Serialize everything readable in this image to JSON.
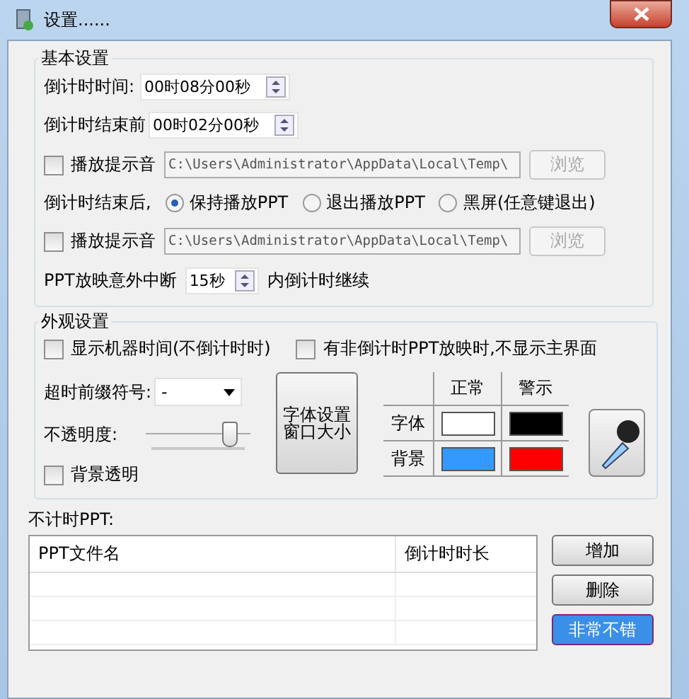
{
  "window": {
    "title": "设置......"
  },
  "basic": {
    "title": "基本设置",
    "countdown": {
      "label": "倒计时时间:",
      "value": "00时08分00秒"
    },
    "before_end": {
      "label": "倒计时结束前",
      "value": "00时02分00秒"
    },
    "sound1": {
      "label": "播放提示音",
      "checked": false,
      "path": "C:\\Users\\Administrator\\AppData\\Local\\Temp\\",
      "browse": "浏览"
    },
    "after_end": {
      "label": "倒计时结束后,",
      "options": [
        {
          "label": "保持播放PPT",
          "selected": true
        },
        {
          "label": "退出播放PPT",
          "selected": false
        },
        {
          "label": "黑屏(任意键退出)",
          "selected": false
        }
      ]
    },
    "sound2": {
      "label": "播放提示音",
      "checked": false,
      "path": "C:\\Users\\Administrator\\AppData\\Local\\Temp\\",
      "browse": "浏览"
    },
    "interrupt": {
      "label": "PPT放映意外中断",
      "value": "15秒",
      "suffix": "内倒计时继续"
    }
  },
  "appearance": {
    "title": "外观设置",
    "show_clock": {
      "label": "显示机器时间(不倒计时时)",
      "checked": false
    },
    "hide_main": {
      "label": "有非倒计时PPT放映时,不显示主界面",
      "checked": false
    },
    "prefix": {
      "label": "超时前缀符号:",
      "value": "-"
    },
    "opacity": {
      "label": "不透明度:",
      "level": 0.8
    },
    "transparent": {
      "label": "背景透明",
      "checked": false
    },
    "font_button": [
      "字体设置",
      "窗口大小"
    ],
    "colors": {
      "columns": [
        "正常",
        "警示"
      ],
      "rows": [
        {
          "label": "字体",
          "swatches": [
            {
              "color": "#ffffff"
            },
            {
              "color": "#000000"
            }
          ]
        },
        {
          "label": "背景",
          "swatches": [
            {
              "color": "#3399ff"
            },
            {
              "color": "#ff0000"
            }
          ]
        }
      ]
    }
  },
  "untimed": {
    "label": "不计时PPT:",
    "columns": [
      "PPT文件名",
      "倒计时时长"
    ],
    "buttons": [
      "增加",
      "删除",
      "非常不错"
    ]
  }
}
